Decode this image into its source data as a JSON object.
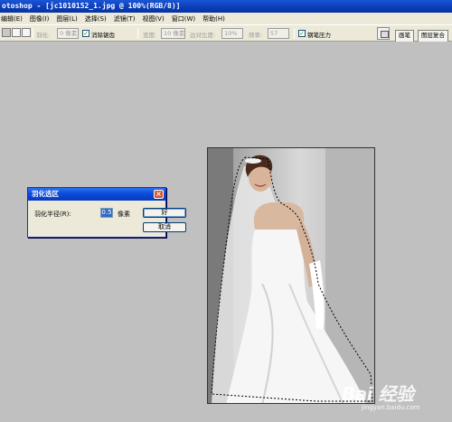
{
  "window": {
    "title": "otoshop - [jc1010152_1.jpg @ 100%(RGB/8)]"
  },
  "menu": {
    "items": [
      "编辑(E)",
      "图像(I)",
      "图层(L)",
      "选择(S)",
      "滤镜(T)",
      "视图(V)",
      "窗口(W)",
      "帮助(H)"
    ]
  },
  "options": {
    "feather_label": "羽化:",
    "feather_value": "0 像素",
    "antialias_label": "消除锯齿",
    "width_label": "宽度:",
    "width_value": "10 像素",
    "contrast_label": "边对比度:",
    "contrast_value": "10%",
    "frequency_label": "频率:",
    "frequency_value": "57",
    "pen_pressure_label": "钢笔压力",
    "tabs": [
      "画笔",
      "图层复合"
    ]
  },
  "dialog": {
    "title": "羽化选区",
    "radius_label": "羽化半径(R):",
    "radius_value": "0.5",
    "unit": "像素",
    "ok_label": "好",
    "cancel_label": "取消"
  },
  "watermark": {
    "logo": "Bai 经验",
    "url": "jingyan.baidu.com"
  },
  "colors": {
    "titlebar": "#0a3cb8",
    "menubar": "#ece9d8",
    "workspace": "#c0c0c0",
    "dialog_close": "#d8562e"
  }
}
